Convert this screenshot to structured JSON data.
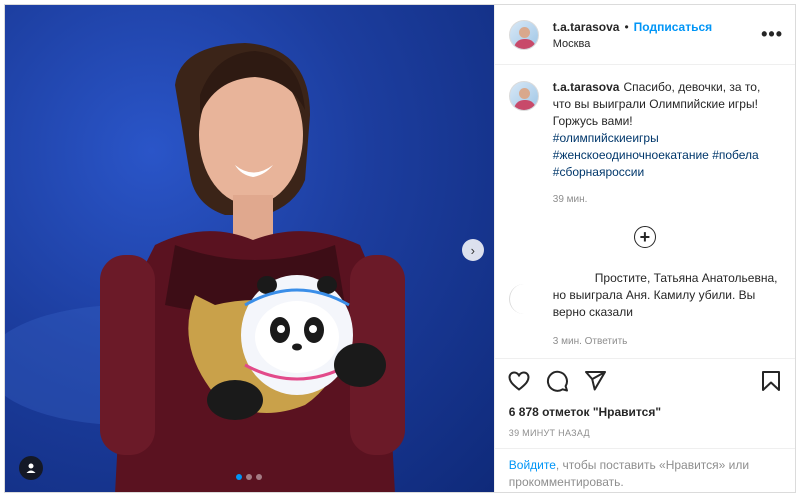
{
  "post": {
    "slide_count": 3,
    "active_slide": 0
  },
  "header": {
    "username": "t.a.tarasova",
    "separator": "•",
    "follow_label": "Подписаться",
    "location": "Москва",
    "more_label": "•••"
  },
  "caption": {
    "username": "t.a.tarasova",
    "text": "Спасибо, девочки, за то, что вы выиграли Олимпийские игры! Горжусь вами!",
    "hashtags": [
      "#олимпийскиеигры",
      "#женскоеодиночноекатание",
      "#побела",
      "#сборнаяроссии"
    ],
    "time": "39 мин."
  },
  "load_more_label": "+",
  "comment": {
    "text": "Простите, Татьяна Анатольевна, но выиграла Аня. Камилу убили. Вы верно сказали",
    "meta": "3 мин.   Ответить"
  },
  "likes": "6 878 отметок \"Нравится\"",
  "posted": "39 МИНУТ НАЗАД",
  "login": {
    "link": "Войдите",
    "rest": ", чтобы поставить «Нравится» или прокомментировать."
  },
  "colors": {
    "accent": "#0095f6",
    "hashtag": "#00376b",
    "muted": "#8e8e8e",
    "media_bg": "#1b3fa6"
  },
  "icons": {
    "like": "heart-icon",
    "comment": "comment-icon",
    "share": "paper-plane-icon",
    "save": "bookmark-icon",
    "next": "chevron-right-icon",
    "tag": "user-tag-icon"
  }
}
